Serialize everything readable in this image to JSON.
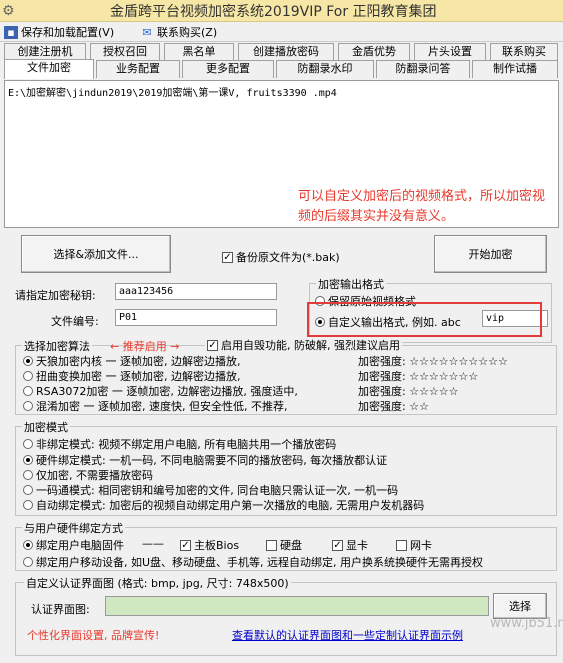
{
  "window": {
    "title": "金盾跨平台视频加密系统2019VIP For 正阳教育集团"
  },
  "menu": {
    "save_load": "保存和加载配置(V)",
    "contact": "联系购买(Z)"
  },
  "tabs_row1": [
    "创建注册机",
    "授权召回",
    "黑名单",
    "创建播放密码",
    "金盾优势",
    "片头设置",
    "联系购买"
  ],
  "tabs_row2": [
    "文件加密",
    "业务配置",
    "更多配置",
    "防翻录水印",
    "防翻录问答",
    "制作试播"
  ],
  "file_list": {
    "path": "E:\\加密解密\\jindun2019\\2019加密端\\第一课V, fruits3390 .mp4"
  },
  "annotation": "可以自定义加密后的视频格式，所以加密视频的后缀其实并没有意义。",
  "buttons": {
    "select_add": "选择&添加文件...",
    "start": "开始加密",
    "browse": "选择"
  },
  "backup": {
    "label": "备份原文件为(*.bak)",
    "checked": true
  },
  "password": {
    "label": "请指定加密秘钥:",
    "value": "aaa123456"
  },
  "file_no": {
    "label": "文件编号:",
    "value": "P01"
  },
  "output": {
    "title": "加密输出格式",
    "keep": "保留原始视频格式",
    "custom": "自定义输出格式, 例如. abc",
    "custom_value": "vip"
  },
  "algorithm": {
    "title": "选择加密算法",
    "recommend": "← 推荐启用 →",
    "self_destroy": "启用自毁功能, 防破解, 强烈建议启用",
    "items": [
      {
        "text": "天狼加密内核 一 逐帧加密, 边解密边播放,",
        "strength": "加密强度: ☆☆☆☆☆☆☆☆☆☆",
        "selected": true
      },
      {
        "text": "扭曲变换加密 一 逐帧加密, 边解密边播放,",
        "strength": "加密强度: ☆☆☆☆☆☆☆",
        "selected": false
      },
      {
        "text": "RSA3072加密 一 逐帧加密, 边解密边播放, 强度适中,",
        "strength": "加密强度: ☆☆☆☆☆",
        "selected": false
      },
      {
        "text": "混淆加密 一 逐帧加密, 速度快, 但安全性低, 不推荐,",
        "strength": "加密强度: ☆☆",
        "selected": false
      }
    ]
  },
  "mode": {
    "title": "加密模式",
    "items": [
      {
        "text": "非绑定模式: 视频不绑定用户电脑, 所有电脑共用一个播放密码",
        "selected": false
      },
      {
        "text": "硬件绑定模式: 一机一码, 不同电脑需要不同的播放密码, 每次播放都认证",
        "selected": true
      },
      {
        "text": "仅加密, 不需要播放密码",
        "selected": false
      },
      {
        "text": "一码通模式: 相同密钥和编号加密的文件, 同台电脑只需认证一次, 一机一码",
        "selected": false
      },
      {
        "text": "自动绑定模式: 加密后的视频自动绑定用户第一次播放的电脑, 无需用户发机器码",
        "selected": false
      }
    ]
  },
  "hardware": {
    "title": "与用户硬件绑定方式",
    "bind_pc": "绑定用户电脑固件",
    "dash": "——",
    "options": [
      {
        "label": "主板Bios",
        "checked": true
      },
      {
        "label": "硬盘",
        "checked": false
      },
      {
        "label": "显卡",
        "checked": true
      },
      {
        "label": "网卡",
        "checked": false
      }
    ],
    "bind_mobile": "绑定用户移动设备, 如U盘、移动硬盘、手机等, 远程自动绑定, 用户换系统换硬件无需再授权"
  },
  "auth_ui": {
    "title": "自定义认证界面图 (格式: bmp, jpg, 尺寸: 748x500)",
    "label": "认证界面图:",
    "value": "",
    "promo": "个性化界面设置, 品牌宣传!",
    "link": "查看默认的认证界面图和一些定制认证界面示例"
  },
  "watermark": "www.jb51.net"
}
